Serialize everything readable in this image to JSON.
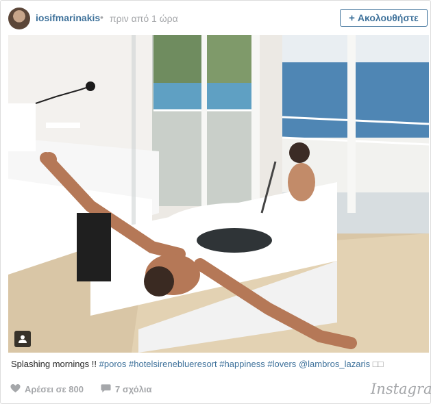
{
  "post": {
    "username": "iosifmarinakis",
    "separator": "•",
    "timestamp": "πριν από 1 ώρα",
    "follow_label": "Ακολουθήστε"
  },
  "caption": {
    "text": "Splashing mornings !! ",
    "hashtags": [
      "#poros",
      "#hotelsireneblueresort",
      "#happiness",
      "#lovers"
    ],
    "mention": "@lambros_lazaris",
    "trailing": "□□"
  },
  "footer": {
    "likes_label": "Αρέσει σε 800",
    "comments_label": "7 σχόλια",
    "brand": "Instagram"
  },
  "icons": {
    "follow": "plus-icon",
    "photo_tag": "user-tag-icon",
    "like": "heart-icon",
    "comment": "comment-bubble-icon"
  },
  "colors": {
    "link": "#3f729b",
    "muted": "#a5a7aa",
    "text": "#262626",
    "border": "#dcdcdc"
  }
}
